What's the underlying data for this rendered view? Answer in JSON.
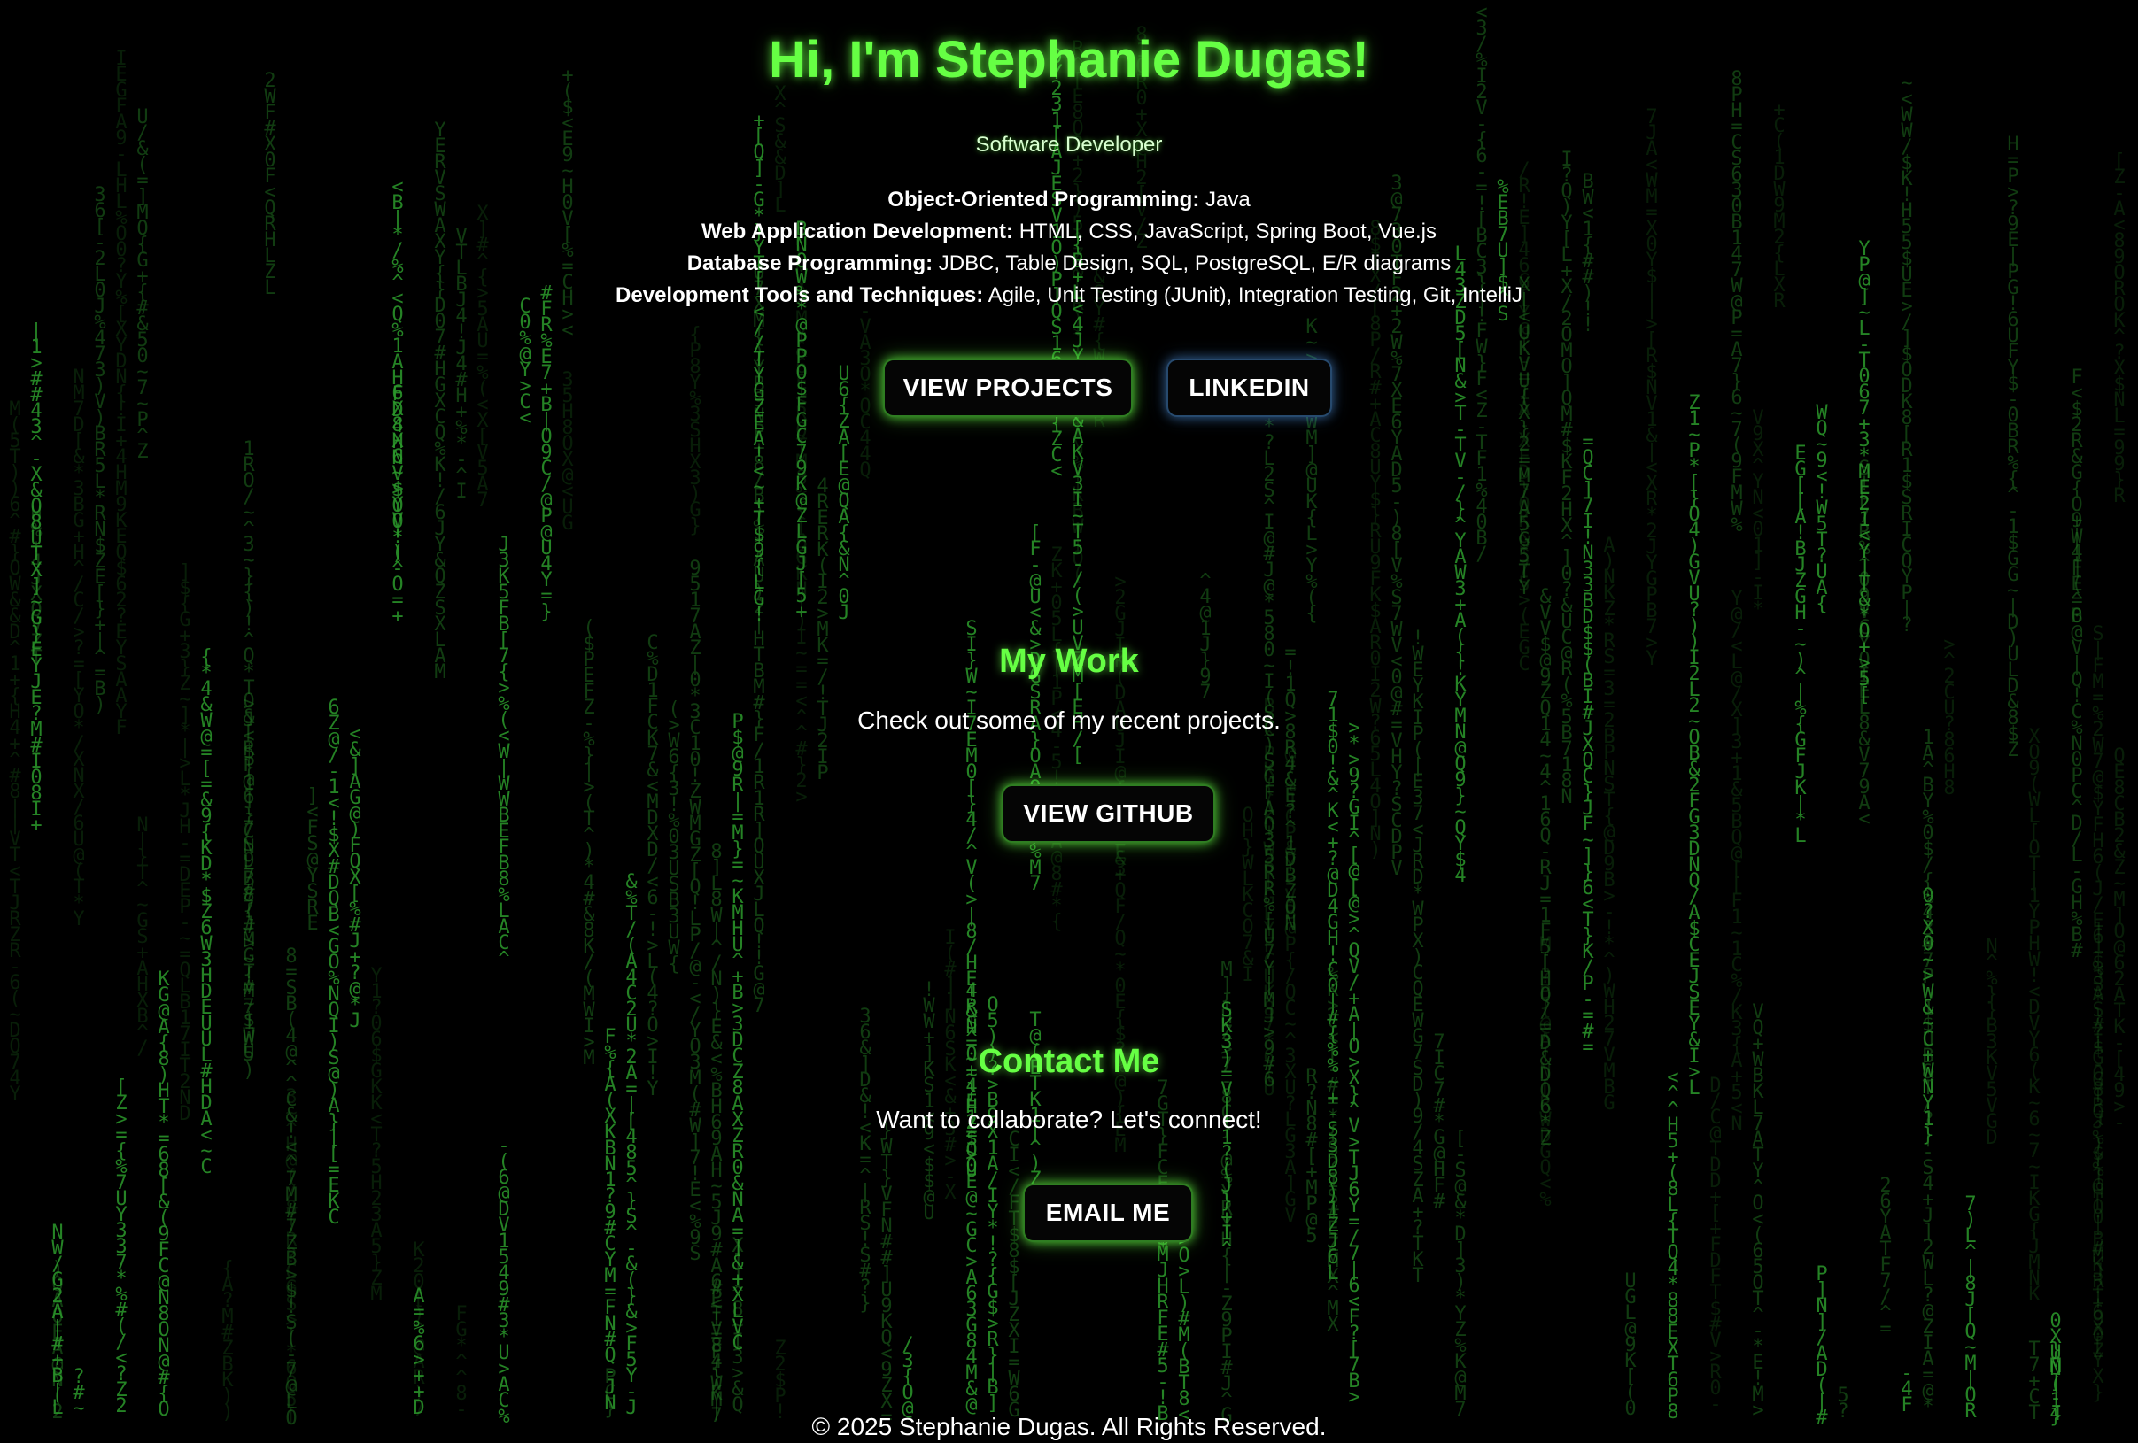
{
  "hero": {
    "title": "Hi, I'm Stephanie Dugas!",
    "subtitle": "Software Developer"
  },
  "skills": [
    {
      "label": "Object-Oriented Programming:",
      "value": " Java"
    },
    {
      "label": "Web Application Development:",
      "value": " HTML, CSS, JavaScript, Spring Boot, Vue.js"
    },
    {
      "label": "Database Programming:",
      "value": " JDBC, Table Design, SQL, PostgreSQL, E/R diagrams"
    },
    {
      "label": "Development Tools and Techniques:",
      "value": " Agile, Unit Testing (JUnit), Integration Testing, Git, IntelliJ"
    }
  ],
  "buttons": {
    "view_projects": "VIEW PROJECTS",
    "linkedin": "LINKEDIN",
    "view_github": "VIEW GITHUB",
    "email_me": "EMAIL ME"
  },
  "work": {
    "title": "My Work",
    "text": "Check out some of my recent projects."
  },
  "contact": {
    "title": "Contact Me",
    "text": "Want to collaborate? Let's connect!"
  },
  "footer": {
    "text": "© 2025 Stephanie Dugas. All Rights Reserved."
  },
  "colors": {
    "accent": "#66ff44",
    "background": "#000000",
    "rain": "#1f6e1f"
  }
}
